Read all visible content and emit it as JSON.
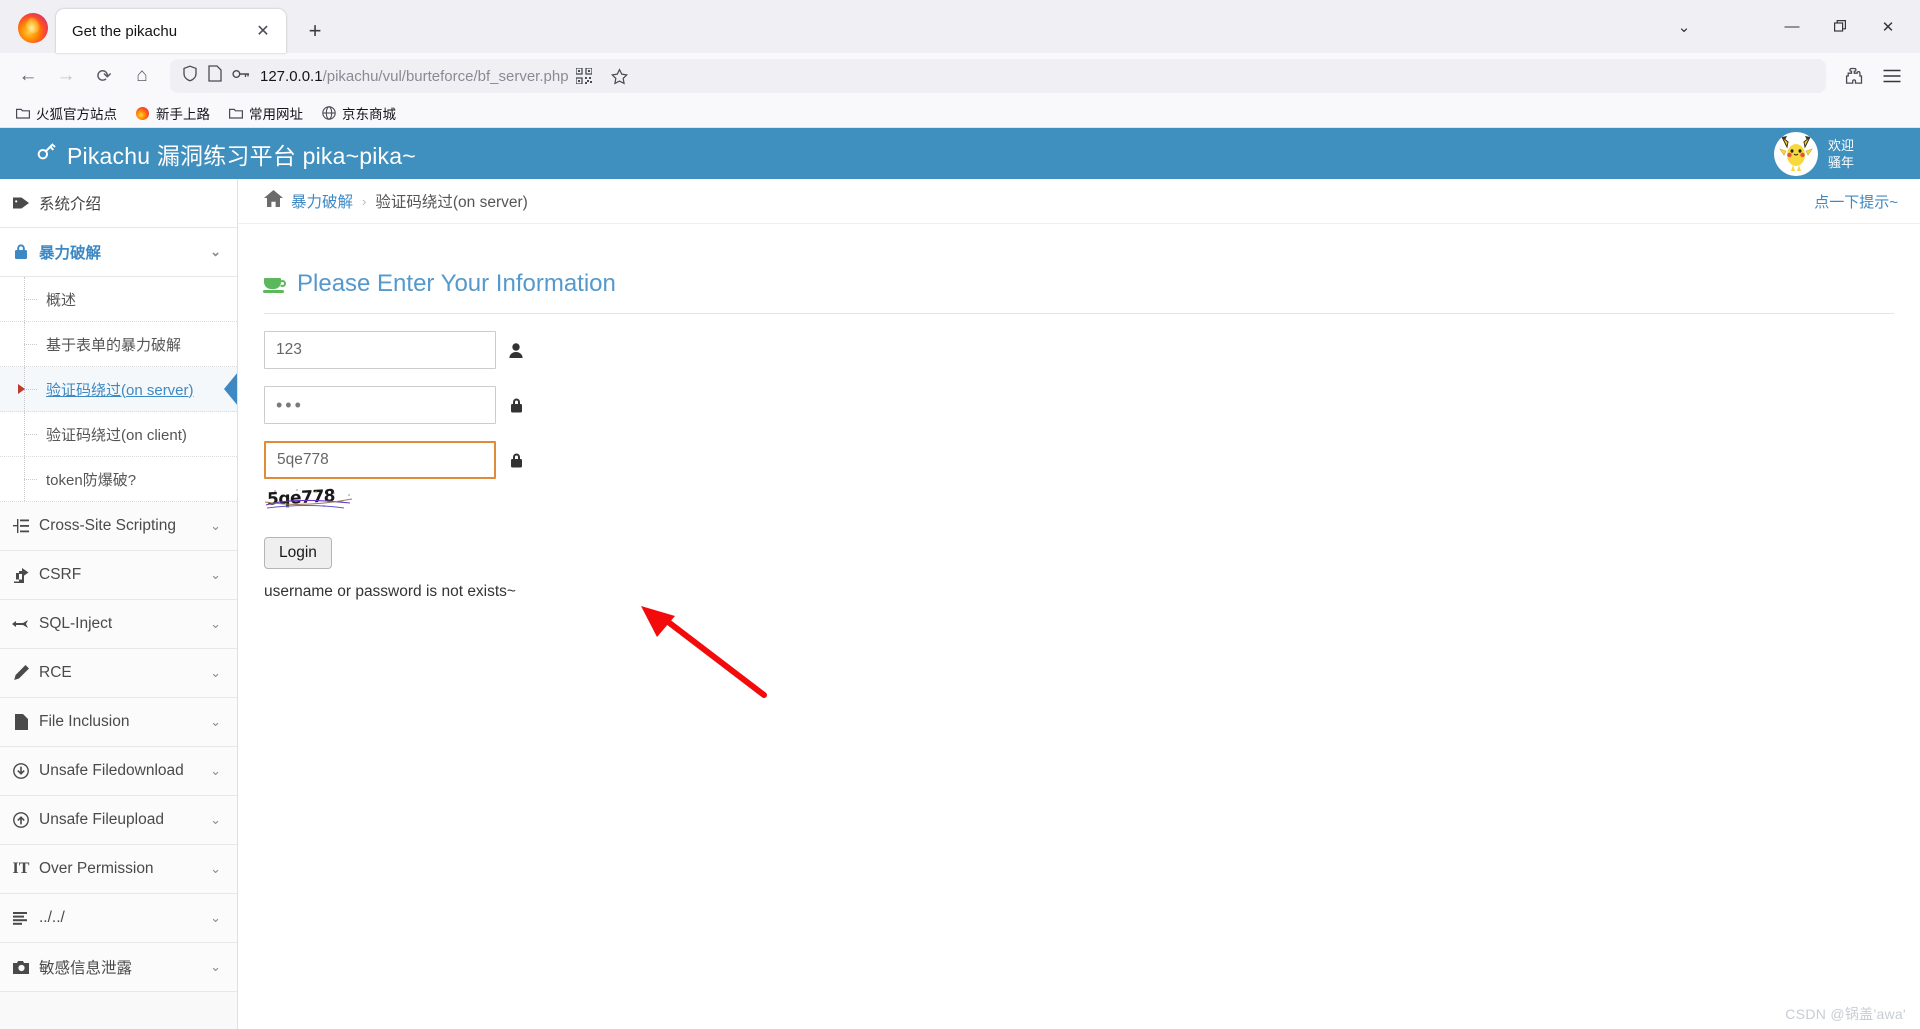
{
  "browser": {
    "tab": {
      "title": "Get the pikachu",
      "close_label": "✕"
    },
    "newtab_label": "+",
    "window_controls": {
      "tab_list": "⌄",
      "minimize": "—",
      "maximize": "❐",
      "close": "✕"
    },
    "nav": {
      "back": "←",
      "forward": "→",
      "reload": "⟳",
      "home": "⌂"
    },
    "url": {
      "host": "127.0.0.1",
      "path": "/pikachu/vul/burteforce/bf_server.php"
    },
    "url_actions": {
      "qr": "qr-code",
      "bookmark": "☆"
    },
    "toolbar_right": {
      "extensions": "puzzle",
      "menu": "≡"
    },
    "bookmarks": [
      {
        "label": "火狐官方站点",
        "icon": "folder"
      },
      {
        "label": "新手上路",
        "icon": "firefox"
      },
      {
        "label": "常用网址",
        "icon": "folder"
      },
      {
        "label": "京东商城",
        "icon": "globe"
      }
    ]
  },
  "site": {
    "header": {
      "title": "Pikachu 漏洞练习平台 pika~pika~",
      "welcome_line1": "欢迎",
      "welcome_line2": "骚年",
      "bg_color": "#3f8fbf"
    },
    "sidebar": [
      {
        "label": "系统介绍",
        "icon": "tag-icon",
        "type": "plain",
        "expandable": false
      },
      {
        "label": "暴力破解",
        "icon": "lock-icon",
        "type": "group",
        "active": true,
        "expandable": true,
        "children": [
          {
            "label": "概述",
            "selected": false
          },
          {
            "label": "基于表单的暴力破解",
            "selected": false
          },
          {
            "label": "验证码绕过(on server)",
            "selected": true
          },
          {
            "label": "验证码绕过(on client)",
            "selected": false
          },
          {
            "label": "token防爆破?",
            "selected": false
          }
        ]
      },
      {
        "label": "Cross-Site Scripting",
        "icon": "sitemap-icon",
        "type": "group",
        "expandable": true
      },
      {
        "label": "CSRF",
        "icon": "share-icon",
        "type": "group",
        "expandable": true
      },
      {
        "label": "SQL-Inject",
        "icon": "plane-icon",
        "type": "group",
        "expandable": true
      },
      {
        "label": "RCE",
        "icon": "pencil-icon",
        "type": "group",
        "expandable": true
      },
      {
        "label": "File Inclusion",
        "icon": "file-icon",
        "type": "group",
        "expandable": true
      },
      {
        "label": "Unsafe Filedownload",
        "icon": "download-icon",
        "type": "group",
        "expandable": true
      },
      {
        "label": "Unsafe Fileupload",
        "icon": "upload-icon",
        "type": "group",
        "expandable": true
      },
      {
        "label": "Over Permission",
        "icon": "text-icon",
        "type": "group",
        "expandable": true
      },
      {
        "label": "../../",
        "icon": "list-icon",
        "type": "group",
        "expandable": true
      },
      {
        "label": "敏感信息泄露",
        "icon": "camera-icon",
        "type": "group",
        "expandable": true
      }
    ],
    "breadcrumb": {
      "home_icon": "home-icon",
      "parent": "暴力破解",
      "separator": "›",
      "current": "验证码绕过(on server)"
    },
    "hint_link": "点一下提示~",
    "form": {
      "title": "Please Enter Your Information",
      "title_icon": "coffee-cup-icon",
      "username": {
        "value": "123",
        "icon": "user-icon"
      },
      "password": {
        "value": "•••",
        "icon": "lock-icon"
      },
      "captcha_input": {
        "value": "5qe778",
        "icon": "lock-icon",
        "focused": true
      },
      "captcha_image_text": "5qe778",
      "submit_label": "Login",
      "error_message": "username or password is not exists~"
    }
  },
  "watermark": "CSDN @锅盖'awa'"
}
